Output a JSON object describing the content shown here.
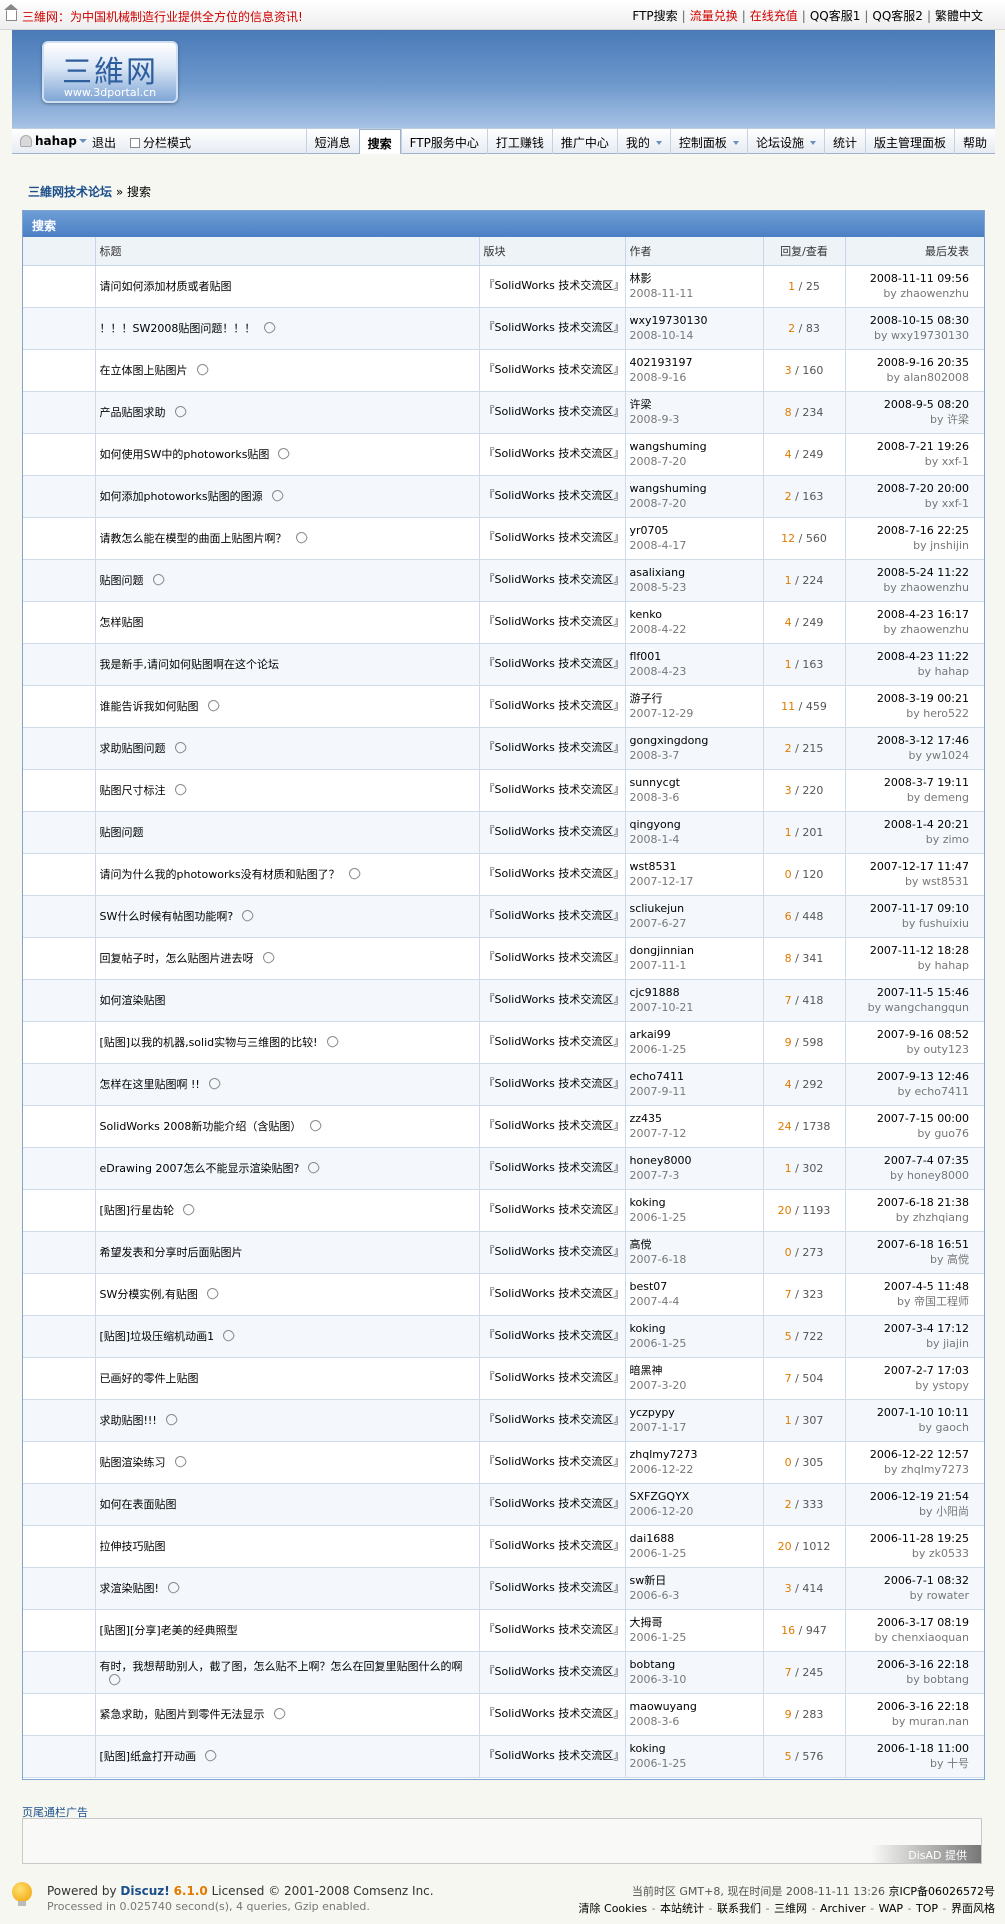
{
  "topbar": {
    "slogan": "三維网：为中国机械制造行业提供全方位的信息资讯!",
    "links": [
      {
        "label": "FTP搜索",
        "red": false
      },
      {
        "label": "流量兑换",
        "red": true
      },
      {
        "label": "在线充值",
        "red": true
      },
      {
        "label": "QQ客服1",
        "red": false
      },
      {
        "label": "QQ客服2",
        "red": false
      },
      {
        "label": "繁體中文",
        "red": false
      }
    ]
  },
  "logo": {
    "mark": "三維网",
    "url": "www.3dportal.cn"
  },
  "navbar": {
    "username": "hahap",
    "logout": "退出",
    "mode": "分栏模式",
    "menu": [
      {
        "label": "短消息",
        "dropdown": false,
        "active": false
      },
      {
        "label": "搜索",
        "dropdown": false,
        "active": true
      },
      {
        "label": "FTP服务中心",
        "dropdown": false,
        "active": false
      },
      {
        "label": "打工赚钱",
        "dropdown": false,
        "active": false
      },
      {
        "label": "推广中心",
        "dropdown": false,
        "active": false
      },
      {
        "label": "我的",
        "dropdown": true,
        "active": false
      },
      {
        "label": "控制面板",
        "dropdown": true,
        "active": false
      },
      {
        "label": "论坛设施",
        "dropdown": true,
        "active": false
      },
      {
        "label": "统计",
        "dropdown": false,
        "active": false
      },
      {
        "label": "版主管理面板",
        "dropdown": false,
        "active": false
      },
      {
        "label": "帮助",
        "dropdown": false,
        "active": false
      }
    ]
  },
  "breadcrumb": {
    "forum": "三維网技术论坛",
    "separator": "»",
    "current": "搜索"
  },
  "results": {
    "title": "搜索",
    "headers": {
      "subject": "标题",
      "forum": "版块",
      "author": "作者",
      "stats": "回复/查看",
      "lastpost": "最后发表"
    },
    "by_label": "by",
    "rows": [
      {
        "subject": "请问如何添加材质或者贴图",
        "attach": false,
        "forum": "『SolidWorks 技术交流区』",
        "author": "林影",
        "date": "2008-11-11",
        "replies": "1",
        "views": "25",
        "last_date": "2008-11-11 09:56",
        "last_by": "zhaowenzhu"
      },
      {
        "subject": "！！！SW2008贴图问题！！！",
        "attach": true,
        "forum": "『SolidWorks 技术交流区』",
        "author": "wxy19730130",
        "date": "2008-10-14",
        "replies": "2",
        "views": "83",
        "last_date": "2008-10-15 08:30",
        "last_by": "wxy19730130"
      },
      {
        "subject": "在立体图上贴图片",
        "attach": true,
        "forum": "『SolidWorks 技术交流区』",
        "author": "402193197",
        "date": "2008-9-16",
        "replies": "3",
        "views": "160",
        "last_date": "2008-9-16 20:35",
        "last_by": "alan802008"
      },
      {
        "subject": "产品贴图求助",
        "attach": true,
        "forum": "『SolidWorks 技术交流区』",
        "author": "许梁",
        "date": "2008-9-3",
        "replies": "8",
        "views": "234",
        "last_date": "2008-9-5 08:20",
        "last_by": "许梁"
      },
      {
        "subject": "如何使用SW中的photoworks贴图",
        "attach": true,
        "forum": "『SolidWorks 技术交流区』",
        "author": "wangshuming",
        "date": "2008-7-20",
        "replies": "4",
        "views": "249",
        "last_date": "2008-7-21 19:26",
        "last_by": "xxf-1"
      },
      {
        "subject": "如何添加photoworks贴图的图源",
        "attach": true,
        "forum": "『SolidWorks 技术交流区』",
        "author": "wangshuming",
        "date": "2008-7-20",
        "replies": "2",
        "views": "163",
        "last_date": "2008-7-20 20:00",
        "last_by": "xxf-1"
      },
      {
        "subject": "请教怎么能在模型的曲面上贴图片啊？",
        "attach": true,
        "forum": "『SolidWorks 技术交流区』",
        "author": "yr0705",
        "date": "2008-4-17",
        "replies": "12",
        "views": "560",
        "last_date": "2008-7-16 22:25",
        "last_by": "jnshijin"
      },
      {
        "subject": "贴图问题",
        "attach": true,
        "forum": "『SolidWorks 技术交流区』",
        "author": "asalixiang",
        "date": "2008-5-23",
        "replies": "1",
        "views": "224",
        "last_date": "2008-5-24 11:22",
        "last_by": "zhaowenzhu"
      },
      {
        "subject": "怎样贴图",
        "attach": false,
        "forum": "『SolidWorks 技术交流区』",
        "author": "kenko",
        "date": "2008-4-22",
        "replies": "4",
        "views": "249",
        "last_date": "2008-4-23 16:17",
        "last_by": "zhaowenzhu"
      },
      {
        "subject": "我是新手,请问如何贴图啊在这个论坛",
        "attach": false,
        "forum": "『SolidWorks 技术交流区』",
        "author": "flf001",
        "date": "2008-4-23",
        "replies": "1",
        "views": "163",
        "last_date": "2008-4-23 11:22",
        "last_by": "hahap"
      },
      {
        "subject": "谁能告诉我如何贴图",
        "attach": true,
        "forum": "『SolidWorks 技术交流区』",
        "author": "游子行",
        "date": "2007-12-29",
        "replies": "11",
        "views": "459",
        "last_date": "2008-3-19 00:21",
        "last_by": "hero522"
      },
      {
        "subject": "求助贴图问题",
        "attach": true,
        "forum": "『SolidWorks 技术交流区』",
        "author": "gongxingdong",
        "date": "2008-3-7",
        "replies": "2",
        "views": "215",
        "last_date": "2008-3-12 17:46",
        "last_by": "yw1024"
      },
      {
        "subject": "贴图尺寸标注",
        "attach": true,
        "forum": "『SolidWorks 技术交流区』",
        "author": "sunnycgt",
        "date": "2008-3-6",
        "replies": "3",
        "views": "220",
        "last_date": "2008-3-7 19:11",
        "last_by": "demeng"
      },
      {
        "subject": "贴图问题",
        "attach": false,
        "forum": "『SolidWorks 技术交流区』",
        "author": "qingyong",
        "date": "2008-1-4",
        "replies": "1",
        "views": "201",
        "last_date": "2008-1-4 20:21",
        "last_by": "zimo"
      },
      {
        "subject": "请问为什么我的photoworks没有材质和贴图了？",
        "attach": true,
        "forum": "『SolidWorks 技术交流区』",
        "author": "wst8531",
        "date": "2007-12-17",
        "replies": "0",
        "views": "120",
        "last_date": "2007-12-17 11:47",
        "last_by": "wst8531"
      },
      {
        "subject": "SW什么时候有帖图功能啊?",
        "attach": true,
        "forum": "『SolidWorks 技术交流区』",
        "author": "scliukejun",
        "date": "2007-6-27",
        "replies": "6",
        "views": "448",
        "last_date": "2007-11-17 09:10",
        "last_by": "fushuixiu"
      },
      {
        "subject": "回复帖子时，怎么贴图片进去呀",
        "attach": true,
        "forum": "『SolidWorks 技术交流区』",
        "author": "dongjinnian",
        "date": "2007-11-1",
        "replies": "8",
        "views": "341",
        "last_date": "2007-11-12 18:28",
        "last_by": "hahap"
      },
      {
        "subject": "如何渲染贴图",
        "attach": false,
        "forum": "『SolidWorks 技术交流区』",
        "author": "cjc91888",
        "date": "2007-10-21",
        "replies": "7",
        "views": "418",
        "last_date": "2007-11-5 15:46",
        "last_by": "wangchangqun"
      },
      {
        "subject": "[贴图]以我的机器,solid实物与三维图的比较!",
        "attach": true,
        "forum": "『SolidWorks 技术交流区』",
        "author": "arkai99",
        "date": "2006-1-25",
        "replies": "9",
        "views": "598",
        "last_date": "2007-9-16 08:52",
        "last_by": "outy123"
      },
      {
        "subject": "怎样在这里贴图啊 !!",
        "attach": true,
        "forum": "『SolidWorks 技术交流区』",
        "author": "echo7411",
        "date": "2007-9-11",
        "replies": "4",
        "views": "292",
        "last_date": "2007-9-13 12:46",
        "last_by": "echo7411"
      },
      {
        "subject": "SolidWorks 2008新功能介绍（含贴图）",
        "attach": true,
        "forum": "『SolidWorks 技术交流区』",
        "author": "zz435",
        "date": "2007-7-12",
        "replies": "24",
        "views": "1738",
        "last_date": "2007-7-15 00:00",
        "last_by": "guo76"
      },
      {
        "subject": "eDrawing 2007怎么不能显示渲染贴图?",
        "attach": true,
        "forum": "『SolidWorks 技术交流区』",
        "author": "honey8000",
        "date": "2007-7-3",
        "replies": "1",
        "views": "302",
        "last_date": "2007-7-4 07:35",
        "last_by": "honey8000"
      },
      {
        "subject": "[贴图]行星齿轮",
        "attach": true,
        "forum": "『SolidWorks 技术交流区』",
        "author": "koking",
        "date": "2006-1-25",
        "replies": "20",
        "views": "1193",
        "last_date": "2007-6-18 21:38",
        "last_by": "zhzhqiang"
      },
      {
        "subject": "希望发表和分享时后面贴图片",
        "attach": false,
        "forum": "『SolidWorks 技术交流区』",
        "author": "高傥",
        "date": "2007-6-18",
        "replies": "0",
        "views": "273",
        "last_date": "2007-6-18 16:51",
        "last_by": "高傥"
      },
      {
        "subject": "SW分模实例,有贴图",
        "attach": true,
        "forum": "『SolidWorks 技术交流区』",
        "author": "best07",
        "date": "2007-4-4",
        "replies": "7",
        "views": "323",
        "last_date": "2007-4-5 11:48",
        "last_by": "帝国工程师"
      },
      {
        "subject": "[贴图]垃圾压缩机动画1",
        "attach": true,
        "forum": "『SolidWorks 技术交流区』",
        "author": "koking",
        "date": "2006-1-25",
        "replies": "5",
        "views": "722",
        "last_date": "2007-3-4 17:12",
        "last_by": "jiajin"
      },
      {
        "subject": "已画好的零件上贴图",
        "attach": false,
        "forum": "『SolidWorks 技术交流区』",
        "author": "暗黑神",
        "date": "2007-3-20",
        "replies": "7",
        "views": "504",
        "last_date": "2007-2-7 17:03",
        "last_by": "ystopy"
      },
      {
        "subject": "求助贴图!!!",
        "attach": true,
        "forum": "『SolidWorks 技术交流区』",
        "author": "yczpypy",
        "date": "2007-1-17",
        "replies": "1",
        "views": "307",
        "last_date": "2007-1-10 10:11",
        "last_by": "gaoch"
      },
      {
        "subject": "贴图渲染练习",
        "attach": true,
        "forum": "『SolidWorks 技术交流区』",
        "author": "zhqlmy7273",
        "date": "2006-12-22",
        "replies": "0",
        "views": "305",
        "last_date": "2006-12-22 12:57",
        "last_by": "zhqlmy7273"
      },
      {
        "subject": "如何在表面贴图",
        "attach": false,
        "forum": "『SolidWorks 技术交流区』",
        "author": "SXFZGQYX",
        "date": "2006-12-20",
        "replies": "2",
        "views": "333",
        "last_date": "2006-12-19 21:54",
        "last_by": "小阳尚"
      },
      {
        "subject": "拉伸技巧贴图",
        "attach": false,
        "forum": "『SolidWorks 技术交流区』",
        "author": "dai1688",
        "date": "2006-1-25",
        "replies": "20",
        "views": "1012",
        "last_date": "2006-11-28 19:25",
        "last_by": "zk0533"
      },
      {
        "subject": "求渲染贴图!",
        "attach": true,
        "forum": "『SolidWorks 技术交流区』",
        "author": "sw新日",
        "date": "2006-6-3",
        "replies": "3",
        "views": "414",
        "last_date": "2006-7-1 08:32",
        "last_by": "rowater"
      },
      {
        "subject": "[贴图][分享]老美的经典照型",
        "attach": false,
        "forum": "『SolidWorks 技术交流区』",
        "author": "大拇哥",
        "date": "2006-1-25",
        "replies": "16",
        "views": "947",
        "last_date": "2006-3-17 08:19",
        "last_by": "chenxiaoquan"
      },
      {
        "subject": "有时，我想帮助别人，截了图，怎么贴不上啊？怎么在回复里贴图什么的啊",
        "attach": true,
        "forum": "『SolidWorks 技术交流区』",
        "author": "bobtang",
        "date": "2006-3-10",
        "replies": "7",
        "views": "245",
        "last_date": "2006-3-16 22:18",
        "last_by": "bobtang"
      },
      {
        "subject": "紧急求助，贴图片到零件无法显示",
        "attach": true,
        "forum": "『SolidWorks 技术交流区』",
        "author": "maowuyang",
        "date": "2008-3-6",
        "replies": "9",
        "views": "283",
        "last_date": "2006-3-16 22:18",
        "last_by": "muran.nan"
      },
      {
        "subject": "[贴图]纸盒打开动画",
        "attach": true,
        "forum": "『SolidWorks 技术交流区』",
        "author": "koking",
        "date": "2006-1-25",
        "replies": "5",
        "views": "576",
        "last_date": "2006-1-18 11:00",
        "last_by": "十号"
      }
    ]
  },
  "ads": {
    "label": "页尾通栏广告",
    "badge": "DisAD 提供"
  },
  "footer": {
    "powered_prefix": "Powered by",
    "brand": "Discuz!",
    "version": "6.1.0",
    "license": "Licensed © 2001-2008 Comsenz Inc.",
    "processed": "Processed in 0.025740 second(s), 4 queries, Gzip enabled.",
    "timezone": "当前时区 GMT+8, 现在时间是 2008-11-11 13:26",
    "icp": "京ICP备06026572号",
    "links": [
      "清除 Cookies",
      "本站统计",
      "联系我们",
      "三维网",
      "Archiver",
      "WAP",
      "TOP",
      "界面风格"
    ]
  }
}
